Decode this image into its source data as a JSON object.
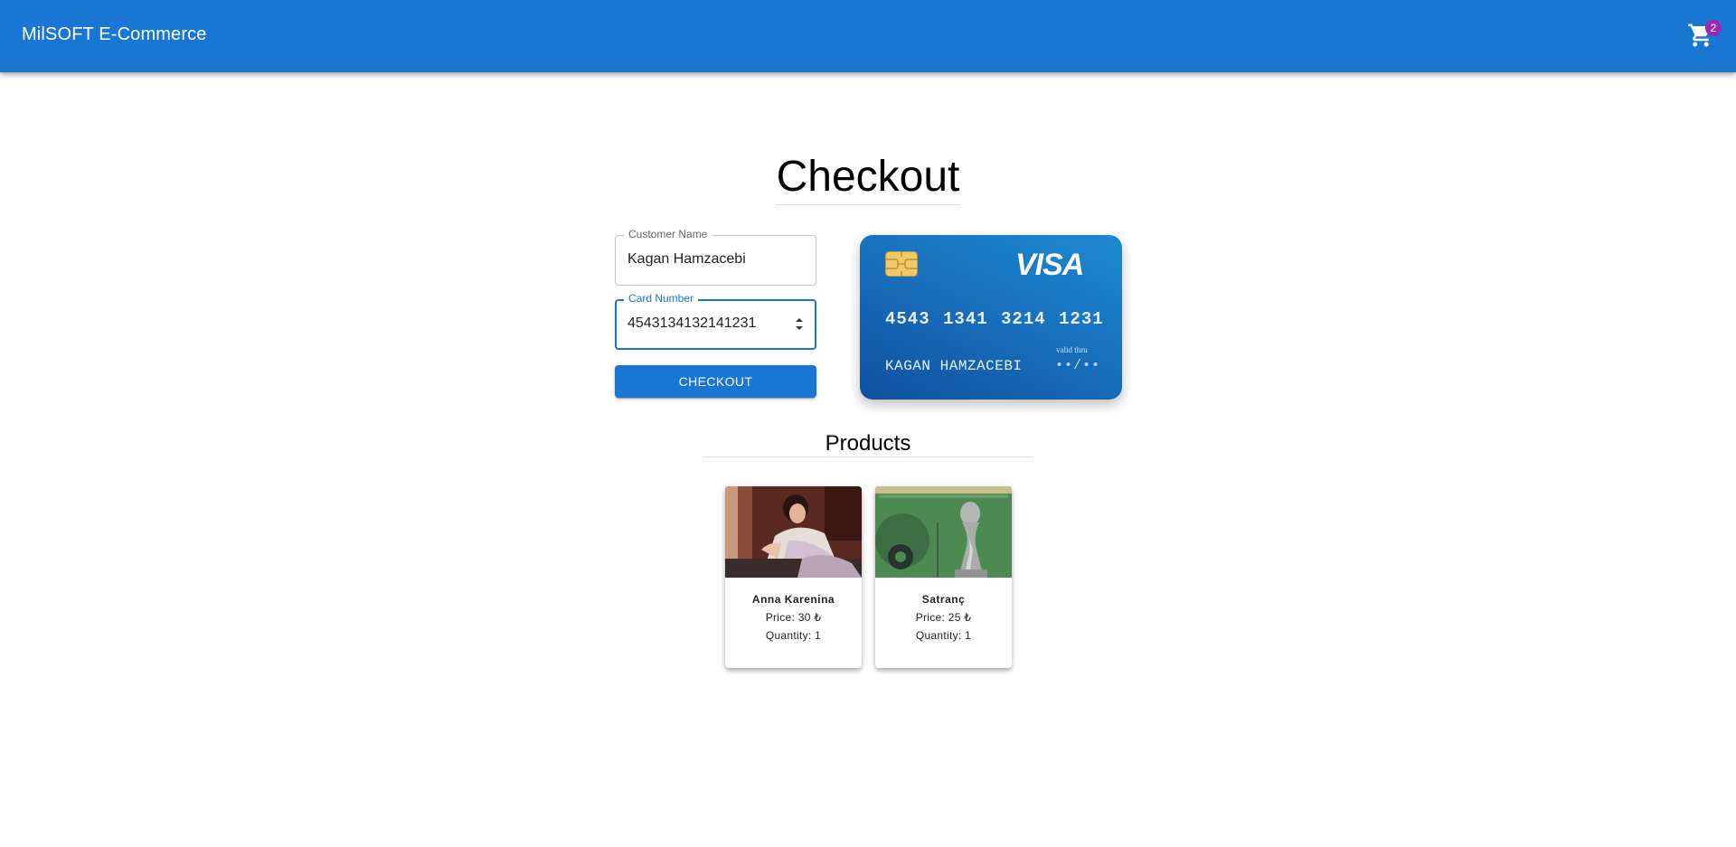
{
  "header": {
    "app_title": "MilSOFT E-Commerce",
    "cart_icon": "shopping-cart-icon",
    "cart_count": "2",
    "accent_color": "#1976d2",
    "badge_color": "#9c27b0"
  },
  "main": {
    "title": "Checkout",
    "form": {
      "customer_name_label": "Customer Name",
      "customer_name_value": "Kagan Hamzacebi",
      "card_number_label": "Card Number",
      "card_number_value": "4543134132141231",
      "checkout_label": "CHECKOUT"
    },
    "card_preview": {
      "brand": "VISA",
      "number": "4543 1341 3214 1231",
      "holder": "KAGAN HAMZACEBI",
      "valid_label": "valid thru",
      "valid_value": "••/••",
      "chip_icon": "card-chip-icon"
    },
    "products_title": "Products",
    "products": [
      {
        "name": "Anna Karenina",
        "price": "Price: 30 ₺",
        "quantity": "Quantity: 1",
        "image": "anna-karenina-cover"
      },
      {
        "name": "Satranç",
        "price": "Price: 25 ₺",
        "quantity": "Quantity: 1",
        "image": "satranc-cover"
      }
    ]
  }
}
